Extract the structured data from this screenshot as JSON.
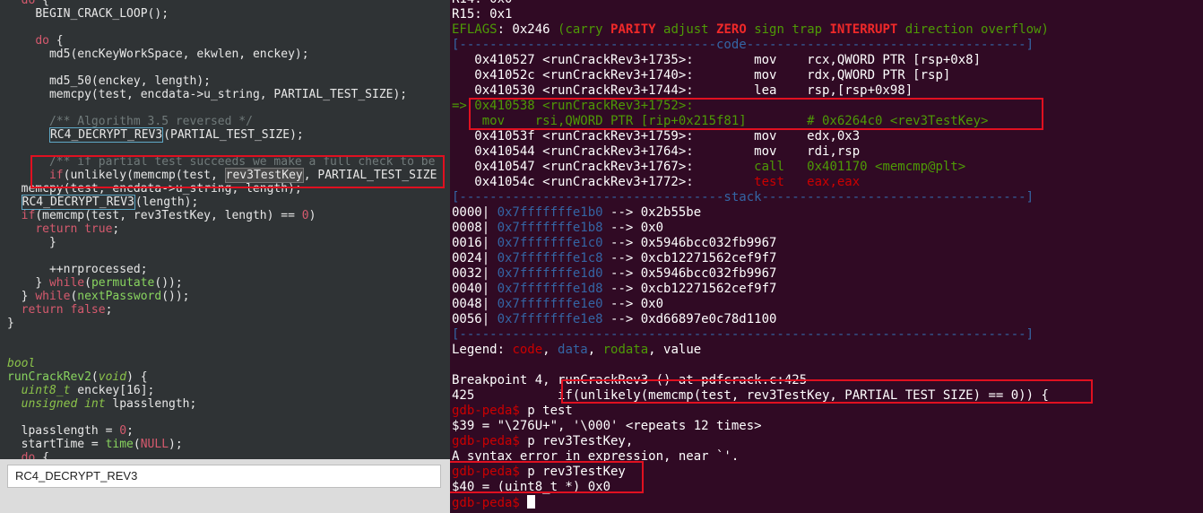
{
  "editor": {
    "lines": [
      {
        "indent": "  ",
        "parts": [
          [
            "kw",
            "do"
          ],
          [
            "",
            " {"
          ]
        ]
      },
      {
        "indent": "    ",
        "parts": [
          [
            "",
            "BEGIN_CRACK_LOOP();"
          ]
        ]
      },
      {
        "indent": "",
        "parts": []
      },
      {
        "indent": "    ",
        "parts": [
          [
            "kw",
            "do"
          ],
          [
            "",
            " {"
          ]
        ]
      },
      {
        "indent": "      ",
        "parts": [
          [
            "",
            "md5(encKeyWorkSpace, ekwlen, enckey);"
          ]
        ]
      },
      {
        "indent": "",
        "parts": []
      },
      {
        "indent": "      ",
        "parts": [
          [
            "",
            "md5_50(enckey, length);"
          ]
        ]
      },
      {
        "indent": "      ",
        "parts": [
          [
            "",
            "memcpy(test, encdata->u_string, PARTIAL_TEST_SIZE);"
          ]
        ]
      },
      {
        "indent": "",
        "parts": []
      },
      {
        "indent": "      ",
        "parts": [
          [
            "cmt",
            "/** Algorithm 3.5 reversed */"
          ]
        ]
      },
      {
        "indent": "      ",
        "parts": [
          [
            "box",
            "RC4_DECRYPT_REV3"
          ],
          [
            "",
            "(PARTIAL_TEST_SIZE);"
          ]
        ]
      },
      {
        "indent": "",
        "parts": []
      },
      {
        "indent": "      ",
        "parts": [
          [
            "cmt",
            "/** if partial test succeeds we make a full check to be"
          ]
        ]
      },
      {
        "indent": "      ",
        "parts": [
          [
            "kw",
            "if"
          ],
          [
            "",
            "(unlikely(memcmp(test, "
          ],
          [
            "hl",
            "rev3TestKey"
          ],
          [
            "",
            ", PARTIAL_TEST_SIZE"
          ]
        ]
      },
      {
        "indent": "  ",
        "parts": [
          [
            "",
            "memcpy(test, encdata->u_string, length);"
          ]
        ]
      },
      {
        "indent": "  ",
        "parts": [
          [
            "box",
            "RC4_DECRYPT_REV3"
          ],
          [
            "",
            "(length);"
          ]
        ]
      },
      {
        "indent": "  ",
        "parts": [
          [
            "kw",
            "if"
          ],
          [
            "",
            "(memcmp(test, rev3TestKey, length) == "
          ],
          [
            "num",
            "0"
          ],
          [
            "",
            ")"
          ]
        ]
      },
      {
        "indent": "    ",
        "parts": [
          [
            "kw",
            "return"
          ],
          [
            "",
            " "
          ],
          [
            "kw",
            "true"
          ],
          [
            "",
            ";"
          ]
        ]
      },
      {
        "indent": "      ",
        "parts": [
          [
            "",
            "}"
          ]
        ]
      },
      {
        "indent": "",
        "parts": []
      },
      {
        "indent": "      ",
        "parts": [
          [
            "",
            "++nrprocessed;"
          ]
        ]
      },
      {
        "indent": "    ",
        "parts": [
          [
            "",
            "} "
          ],
          [
            "kw",
            "while"
          ],
          [
            "",
            "("
          ],
          [
            "fn",
            "permutate"
          ],
          [
            "",
            "());"
          ]
        ]
      },
      {
        "indent": "  ",
        "parts": [
          [
            "",
            "} "
          ],
          [
            "kw",
            "while"
          ],
          [
            "",
            "("
          ],
          [
            "fn",
            "nextPassword"
          ],
          [
            "",
            "());"
          ]
        ]
      },
      {
        "indent": "  ",
        "parts": [
          [
            "kw",
            "return"
          ],
          [
            "",
            " "
          ],
          [
            "kw",
            "false"
          ],
          [
            "",
            ";"
          ]
        ]
      },
      {
        "indent": "",
        "parts": [
          [
            "",
            "}"
          ]
        ]
      },
      {
        "indent": "",
        "parts": []
      },
      {
        "indent": "",
        "parts": []
      },
      {
        "indent": "",
        "parts": [
          [
            "typ",
            "bool"
          ]
        ]
      },
      {
        "indent": "",
        "parts": [
          [
            "fn",
            "runCrackRev2"
          ],
          [
            "",
            "("
          ],
          [
            "typ",
            "void"
          ],
          [
            "",
            ") {"
          ]
        ]
      },
      {
        "indent": "  ",
        "parts": [
          [
            "typ",
            "uint8_t"
          ],
          [
            "",
            " enckey[16];"
          ]
        ]
      },
      {
        "indent": "  ",
        "parts": [
          [
            "typ",
            "unsigned int"
          ],
          [
            "",
            " lpasslength;"
          ]
        ]
      },
      {
        "indent": "",
        "parts": []
      },
      {
        "indent": "  ",
        "parts": [
          [
            "",
            "lpasslength = "
          ],
          [
            "num",
            "0"
          ],
          [
            "",
            ";"
          ]
        ]
      },
      {
        "indent": "  ",
        "parts": [
          [
            "",
            "startTime = "
          ],
          [
            "fn",
            "time"
          ],
          [
            "",
            "("
          ],
          [
            "kw",
            "NULL"
          ],
          [
            "",
            ");"
          ]
        ]
      },
      {
        "indent": "  ",
        "parts": [
          [
            "kw",
            "do"
          ],
          [
            "",
            " {"
          ]
        ]
      }
    ],
    "search_value": "RC4_DECRYPT_REV3"
  },
  "terminal": {
    "lines": [
      [
        [
          "",
          "R14: 0x0"
        ]
      ],
      [
        [
          "",
          "R15: 0x1"
        ]
      ],
      [
        [
          "t-green",
          "EFLAGS"
        ],
        [
          "",
          ": 0x246 "
        ],
        [
          "t-green",
          "(carry "
        ],
        [
          "t-red",
          "PARITY"
        ],
        [
          "t-green",
          " adjust "
        ],
        [
          "t-red",
          "ZERO"
        ],
        [
          "t-green",
          " sign trap "
        ],
        [
          "t-red",
          "INTERRUPT"
        ],
        [
          "t-green",
          " direction overflow)"
        ]
      ],
      [
        [
          "t-blue",
          "[----------------------------------code-------------------------------------]"
        ]
      ],
      [
        [
          "",
          "   0x410527 <runCrackRev3+1735>:        mov    rcx,QWORD PTR [rsp+0x8]"
        ]
      ],
      [
        [
          "",
          "   0x41052c <runCrackRev3+1740>:        mov    rdx,QWORD PTR [rsp]"
        ]
      ],
      [
        [
          "",
          "   0x410530 <runCrackRev3+1744>:        lea    rsp,[rsp+0x98]"
        ]
      ],
      [
        [
          "t-green",
          "=> 0x410538 <runCrackRev3+1752>:"
        ]
      ],
      [
        [
          "t-green",
          "    mov    rsi,QWORD PTR [rip+0x215f81]        # 0x6264c0 <rev3TestKey>"
        ]
      ],
      [
        [
          "",
          "   0x41053f <runCrackRev3+1759>:        mov    edx,0x3"
        ]
      ],
      [
        [
          "",
          "   0x410544 <runCrackRev3+1764>:        mov    rdi,rsp"
        ]
      ],
      [
        [
          "",
          "   0x410547 <runCrackRev3+1767>:        "
        ],
        [
          "t-green",
          "call   0x401170 <memcmp@plt>"
        ]
      ],
      [
        [
          "",
          "   0x41054c <runCrackRev3+1772>:        "
        ],
        [
          "t-redn",
          "test   eax,eax"
        ]
      ],
      [
        [
          "t-blue",
          "[-----------------------------------stack-----------------------------------]"
        ]
      ],
      [
        [
          "",
          "0000| "
        ],
        [
          "t-blue",
          "0x7fffffffe1b0"
        ],
        [
          "",
          " --> 0x2b55be"
        ]
      ],
      [
        [
          "",
          "0008| "
        ],
        [
          "t-blue",
          "0x7fffffffe1b8"
        ],
        [
          "",
          " --> 0x0"
        ]
      ],
      [
        [
          "",
          "0016| "
        ],
        [
          "t-blue",
          "0x7fffffffe1c0"
        ],
        [
          "",
          " --> 0x5946bcc032fb9967"
        ]
      ],
      [
        [
          "",
          "0024| "
        ],
        [
          "t-blue",
          "0x7fffffffe1c8"
        ],
        [
          "",
          " --> 0xcb12271562cef9f7"
        ]
      ],
      [
        [
          "",
          "0032| "
        ],
        [
          "t-blue",
          "0x7fffffffe1d0"
        ],
        [
          "",
          " --> 0x5946bcc032fb9967"
        ]
      ],
      [
        [
          "",
          "0040| "
        ],
        [
          "t-blue",
          "0x7fffffffe1d8"
        ],
        [
          "",
          " --> 0xcb12271562cef9f7"
        ]
      ],
      [
        [
          "",
          "0048| "
        ],
        [
          "t-blue",
          "0x7fffffffe1e0"
        ],
        [
          "",
          " --> 0x0"
        ]
      ],
      [
        [
          "",
          "0056| "
        ],
        [
          "t-blue",
          "0x7fffffffe1e8"
        ],
        [
          "",
          " --> 0xd66897e0c78d1100"
        ]
      ],
      [
        [
          "t-blue",
          "[---------------------------------------------------------------------------]"
        ]
      ],
      [
        [
          "",
          "Legend: "
        ],
        [
          "t-redn",
          "code"
        ],
        [
          "",
          ", "
        ],
        [
          "t-blue",
          "data"
        ],
        [
          "",
          ", "
        ],
        [
          "t-green",
          "rodata"
        ],
        [
          "",
          ", value"
        ]
      ],
      [],
      [
        [
          "",
          "Breakpoint 4, runCrackRev3 () at pdfcrack.c:425"
        ]
      ],
      [
        [
          "",
          "425           if(unlikely(memcmp(test, rev3TestKey, PARTIAL_TEST_SIZE) == 0)) {"
        ]
      ],
      [
        [
          "t-prompt",
          "gdb-peda$"
        ],
        [
          "",
          " p test"
        ]
      ],
      [
        [
          "",
          "$39 = \"\\276U+\", '\\000' <repeats 12 times>"
        ]
      ],
      [
        [
          "t-prompt",
          "gdb-peda$"
        ],
        [
          "",
          " p rev3TestKey,"
        ]
      ],
      [
        [
          "",
          "A syntax error in expression, near `'."
        ]
      ],
      [
        [
          "t-prompt",
          "gdb-peda$"
        ],
        [
          "",
          " p rev3TestKey"
        ]
      ],
      [
        [
          "",
          "$40 = (uint8_t *) 0x0"
        ]
      ],
      [
        [
          "t-prompt",
          "gdb-peda$"
        ],
        [
          "",
          " "
        ],
        [
          "cursor",
          ""
        ]
      ]
    ]
  }
}
